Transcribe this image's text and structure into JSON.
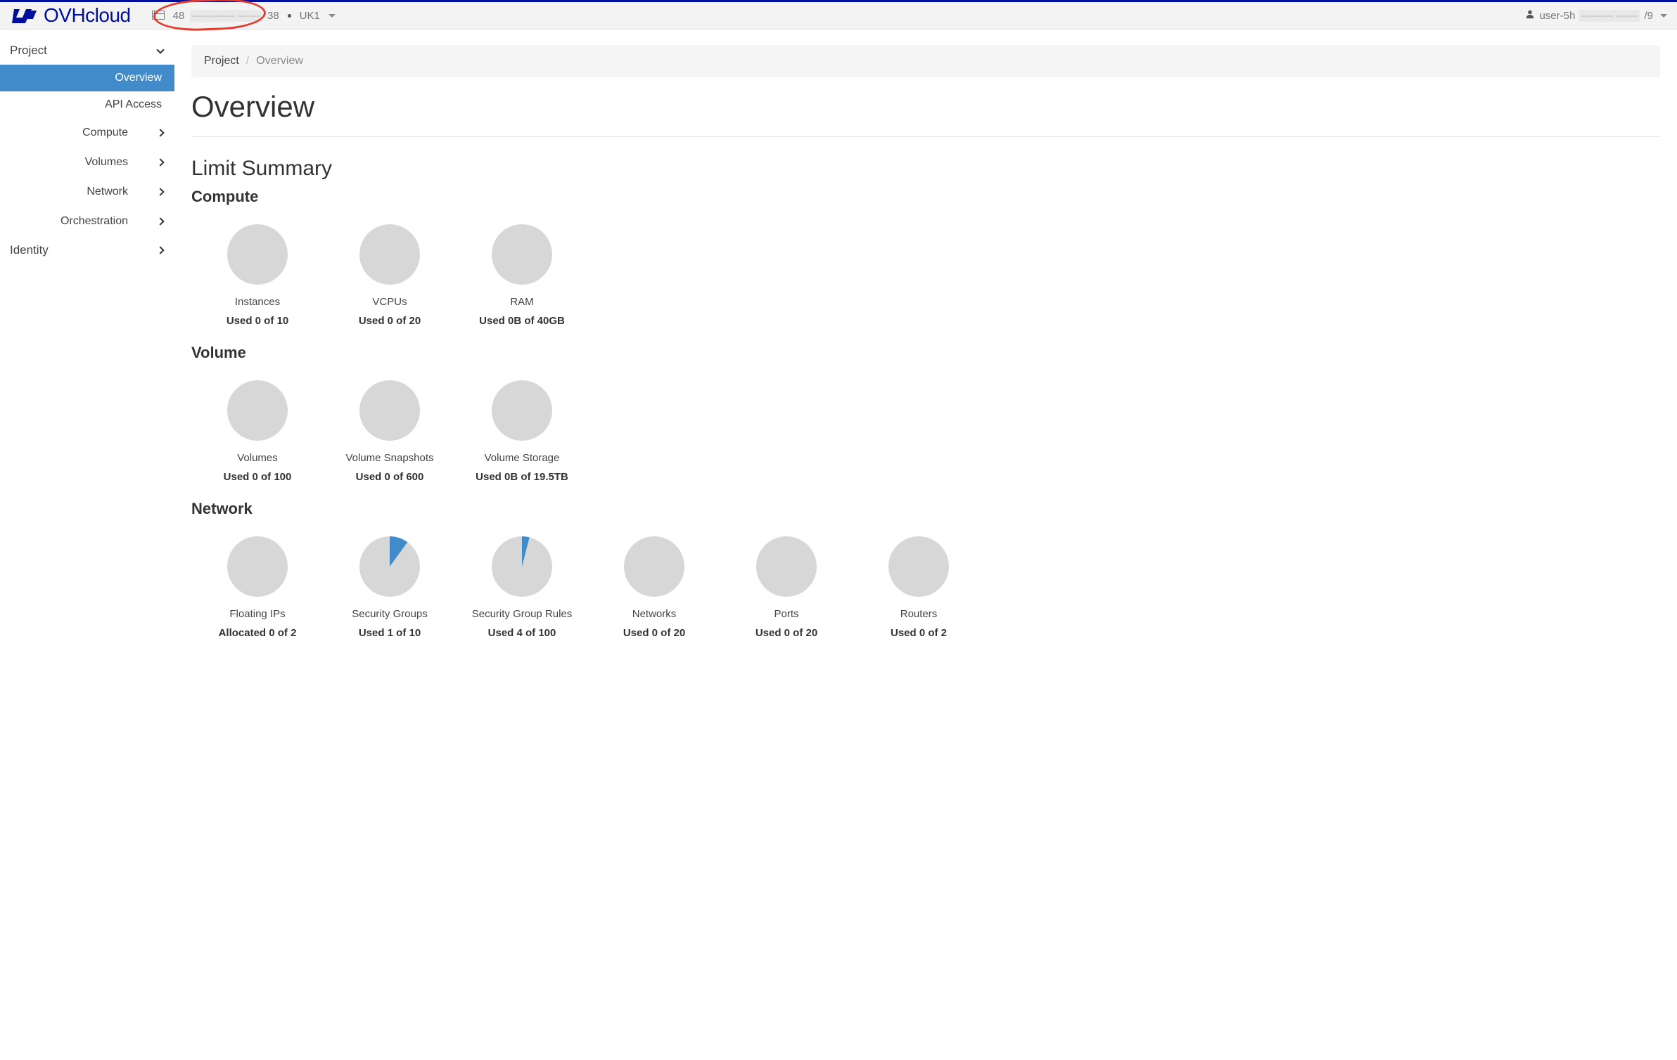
{
  "brand": "OVHcloud",
  "topbar": {
    "project_id_prefix": "48",
    "project_id_mid": "———— ——",
    "project_id_suffix": "38",
    "region": "UK1",
    "user_prefix": "user-5h",
    "user_mid": "——— ——",
    "user_suffix": "/9"
  },
  "sidebar": {
    "root": "Project",
    "items": [
      {
        "label": "Overview",
        "active": true
      },
      {
        "label": "API Access"
      }
    ],
    "groups": [
      {
        "label": "Compute"
      },
      {
        "label": "Volumes"
      },
      {
        "label": "Network"
      },
      {
        "label": "Orchestration"
      }
    ],
    "identity": "Identity"
  },
  "breadcrumb": {
    "root": "Project",
    "current": "Overview"
  },
  "page_title": "Overview",
  "limit_summary_title": "Limit Summary",
  "sections": {
    "compute": {
      "title": "Compute",
      "tiles": [
        {
          "label": "Instances",
          "usage": "Used 0 of 10",
          "filled": 0
        },
        {
          "label": "VCPUs",
          "usage": "Used 0 of 20",
          "filled": 0
        },
        {
          "label": "RAM",
          "usage": "Used 0B of 40GB",
          "filled": 0
        }
      ]
    },
    "volume": {
      "title": "Volume",
      "tiles": [
        {
          "label": "Volumes",
          "usage": "Used 0 of 100",
          "filled": 0
        },
        {
          "label": "Volume Snapshots",
          "usage": "Used 0 of 600",
          "filled": 0
        },
        {
          "label": "Volume Storage",
          "usage": "Used 0B of 19.5TB",
          "filled": 0
        }
      ]
    },
    "network": {
      "title": "Network",
      "tiles": [
        {
          "label": "Floating IPs",
          "usage": "Allocated 0 of 2",
          "filled": 0
        },
        {
          "label": "Security Groups",
          "usage": "Used 1 of 10",
          "filled": 10
        },
        {
          "label": "Security Group Rules",
          "usage": "Used 4 of 100",
          "filled": 4
        },
        {
          "label": "Networks",
          "usage": "Used 0 of 20",
          "filled": 0
        },
        {
          "label": "Ports",
          "usage": "Used 0 of 20",
          "filled": 0
        },
        {
          "label": "Routers",
          "usage": "Used 0 of 2",
          "filled": 0
        }
      ]
    }
  },
  "colors": {
    "accent": "#428bca",
    "pie_empty": "#d7d7d7",
    "pie_fill": "#428bca"
  }
}
